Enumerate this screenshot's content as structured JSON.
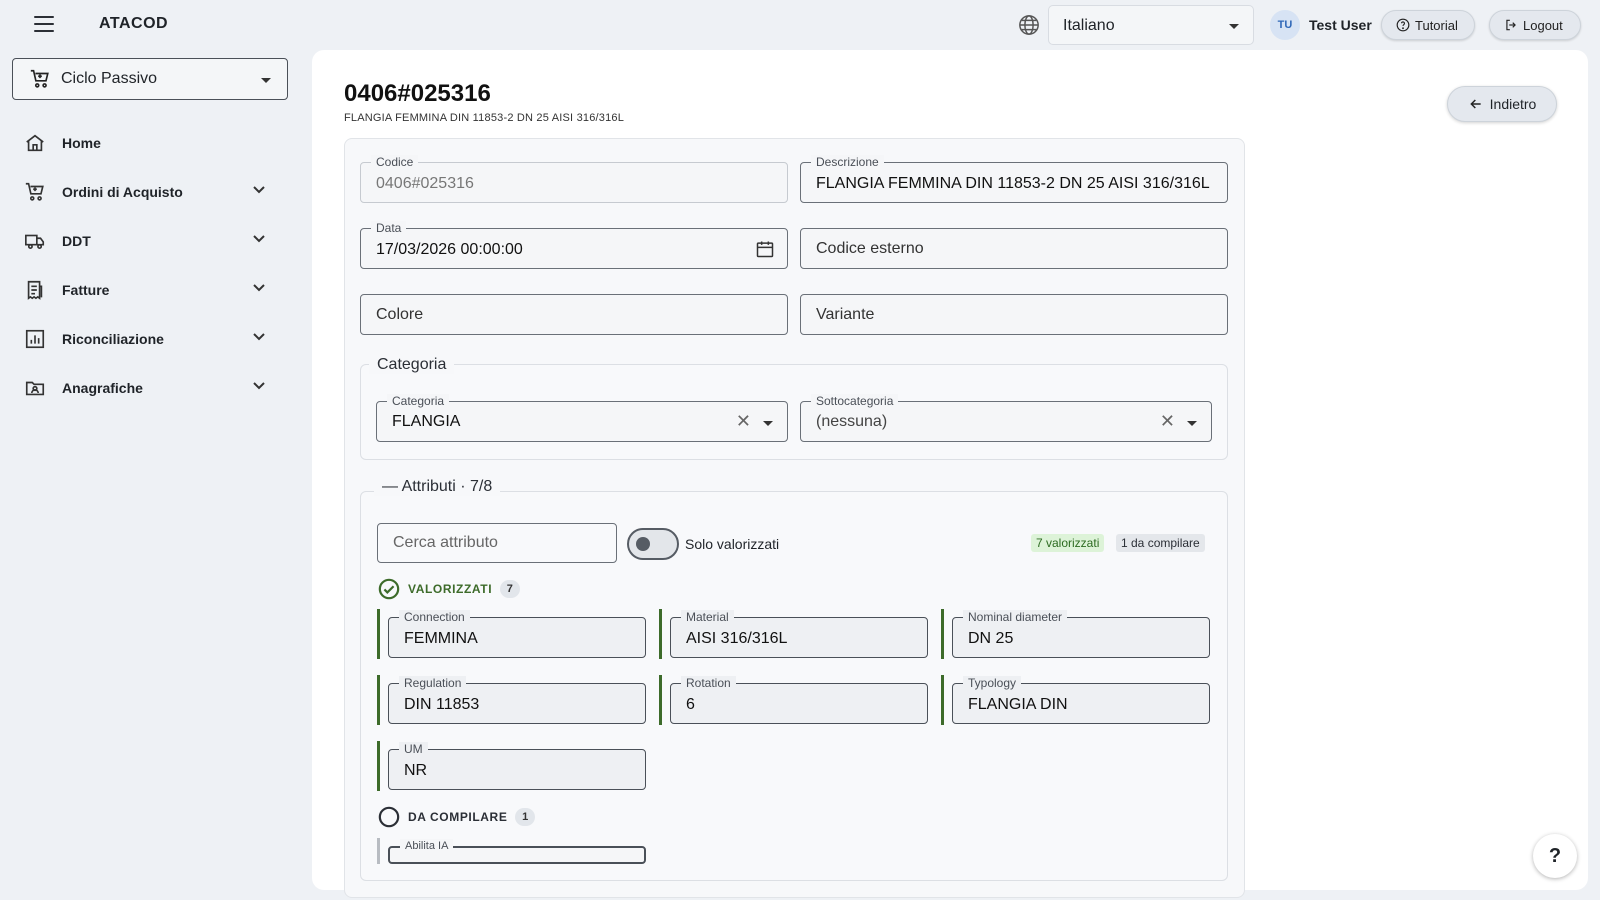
{
  "app": {
    "brand": "ATACOD"
  },
  "header": {
    "language": "Italiano",
    "user_initials": "TU",
    "user_name": "Test User",
    "tutorial_label": "Tutorial",
    "logout_label": "Logout"
  },
  "sidebar": {
    "module": "Ciclo Passivo",
    "items": [
      {
        "label": "Home",
        "icon": "home-icon"
      },
      {
        "label": "Ordini di Acquisto",
        "icon": "cart-icon"
      },
      {
        "label": "DDT",
        "icon": "truck-icon"
      },
      {
        "label": "Fatture",
        "icon": "receipt-icon"
      },
      {
        "label": "Riconciliazione",
        "icon": "chart-icon"
      },
      {
        "label": "Anagrafiche",
        "icon": "folder-user-icon"
      }
    ]
  },
  "page": {
    "title": "0406#025316",
    "subtitle": "FLANGIA FEMMINA DIN 11853-2 DN 25 AISI 316/316L",
    "back_label": "Indietro"
  },
  "form": {
    "codice": {
      "label": "Codice",
      "value": "0406#025316"
    },
    "descrizione": {
      "label": "Descrizione",
      "value": "FLANGIA FEMMINA DIN 11853-2 DN 25 AISI 316/316L"
    },
    "data": {
      "label": "Data",
      "value": "17/03/2026 00:00:00"
    },
    "codice_esterno": {
      "placeholder": "Codice esterno"
    },
    "colore": {
      "placeholder": "Colore"
    },
    "variante": {
      "placeholder": "Variante"
    },
    "categoria_section": "Categoria",
    "categoria": {
      "label": "Categoria",
      "value": "FLANGIA"
    },
    "sottocategoria": {
      "label": "Sottocategoria",
      "value": "(nessuna)"
    }
  },
  "attributi": {
    "legend": "— Attributi · 7/8",
    "search_placeholder": "Cerca attributo",
    "toggle_label": "Solo valorizzati",
    "badge_filled": "7 valorizzati",
    "badge_todo": "1 da compilare",
    "filled_heading": "VALORIZZATI",
    "filled_count": "7",
    "todo_heading": "DA COMPILARE",
    "todo_count": "1",
    "filled": [
      {
        "label": "Connection",
        "value": "FEMMINA"
      },
      {
        "label": "Material",
        "value": "AISI 316/316L"
      },
      {
        "label": "Nominal diameter",
        "value": "DN 25"
      },
      {
        "label": "Regulation",
        "value": "DIN 11853"
      },
      {
        "label": "Rotation",
        "value": "6"
      },
      {
        "label": "Typology",
        "value": "FLANGIA DIN"
      },
      {
        "label": "UM",
        "value": "NR"
      }
    ],
    "todo": [
      {
        "label": "Abilita IA",
        "value": ""
      }
    ]
  },
  "help_label": "?"
}
